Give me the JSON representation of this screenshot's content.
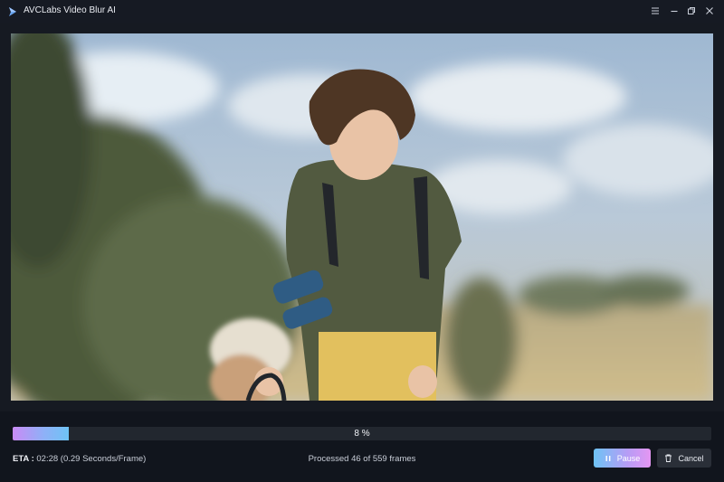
{
  "window": {
    "title": "AVCLabs Video Blur AI",
    "controls": {
      "menu_icon": "menu-icon",
      "minimize_icon": "minimize-icon",
      "restore_icon": "restore-icon",
      "close_icon": "close-icon"
    }
  },
  "preview": {
    "description_icon": "video-preview"
  },
  "progress": {
    "percent": 8,
    "label": "8 %"
  },
  "status": {
    "eta_label": "ETA :",
    "eta_value": "02:28 (0.29 Seconds/Frame)",
    "processed_text": "Processed 46 of 559 frames"
  },
  "buttons": {
    "pause_label": "Pause",
    "cancel_label": "Cancel"
  },
  "colors": {
    "accent_start": "#6ec3f5",
    "accent_end": "#e496f2",
    "background": "#11151d"
  }
}
